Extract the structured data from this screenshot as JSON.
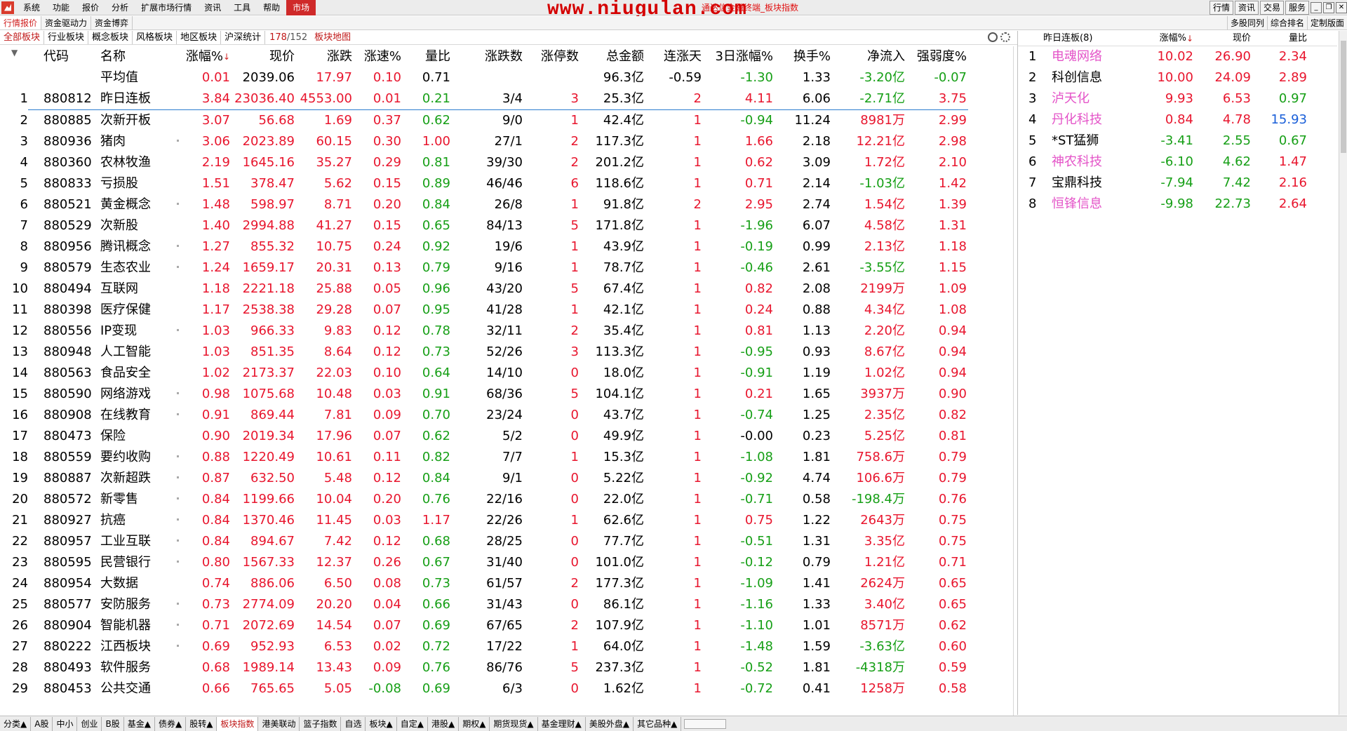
{
  "menubar": {
    "items": [
      "系统",
      "功能",
      "报价",
      "分析",
      "扩展市场行情",
      "资讯",
      "工具",
      "帮助"
    ],
    "active": "市场",
    "title": "通达信金融终端_板块指数",
    "watermark": "www.niugulan.com",
    "right_buttons": [
      "行情",
      "资讯",
      "交易",
      "服务"
    ]
  },
  "tabbar1": {
    "tabs": [
      "行情报价",
      "资金驱动力",
      "资金博弈"
    ],
    "right_tabs": [
      "多股同列",
      "综合排名",
      "定制版面"
    ]
  },
  "tabbar2": {
    "tabs": [
      "全部板块",
      "行业板块",
      "概念板块",
      "风格板块",
      "地区板块",
      "沪深统计"
    ],
    "count": "178",
    "total": "/152",
    "map": "板块地图"
  },
  "headers": {
    "code": "代码",
    "name": "名称",
    "pct": "涨幅%",
    "px": "现价",
    "chg": "涨跌",
    "spd": "涨速%",
    "vr": "量比",
    "ud": "涨跌数",
    "lu": "涨停数",
    "amt": "总金额",
    "cd": "连涨天",
    "d3": "3日涨幅%",
    "tr": "换手%",
    "nf": "净流入",
    "st": "强弱度%",
    "sort_arrow": "↓"
  },
  "average": {
    "name": "平均值",
    "pct": "0.01",
    "px": "2039.06",
    "chg": "17.97",
    "spd": "0.10",
    "vr": "0.71",
    "amt": "96.3亿",
    "cd": "-0.59",
    "d3": "-1.30",
    "tr": "1.33",
    "nf": "-3.20亿",
    "st": "-0.07"
  },
  "rows": [
    {
      "n": "1",
      "code": "880812",
      "name": "昨日连板",
      "pct": "3.84",
      "px": "23036.40",
      "chg": "4553.00",
      "spd": "0.01",
      "vr": "0.21",
      "ud": "3/4",
      "lu": "3",
      "amt": "25.3亿",
      "cd": "2",
      "d3": "4.11",
      "tr": "6.06",
      "nf": "-2.71亿",
      "st": "3.75"
    },
    {
      "n": "2",
      "code": "880885",
      "name": "次新开板",
      "pct": "3.07",
      "px": "56.68",
      "chg": "1.69",
      "spd": "0.37",
      "vr": "0.62",
      "ud": "9/0",
      "lu": "1",
      "amt": "42.4亿",
      "cd": "1",
      "d3": "-0.94",
      "tr": "11.24",
      "nf": "8981万",
      "st": "2.99"
    },
    {
      "n": "3",
      "code": "880936",
      "name": "猪肉",
      "pct": "3.06",
      "px": "2023.89",
      "chg": "60.15",
      "spd": "0.30",
      "vr": "1.00",
      "ud": "27/1",
      "lu": "2",
      "amt": "117.3亿",
      "cd": "1",
      "d3": "1.66",
      "tr": "2.18",
      "nf": "12.21亿",
      "st": "2.98"
    },
    {
      "n": "4",
      "code": "880360",
      "name": "农林牧渔",
      "pct": "2.19",
      "px": "1645.16",
      "chg": "35.27",
      "spd": "0.29",
      "vr": "0.81",
      "ud": "39/30",
      "lu": "2",
      "amt": "201.2亿",
      "cd": "1",
      "d3": "0.62",
      "tr": "3.09",
      "nf": "1.72亿",
      "st": "2.10"
    },
    {
      "n": "5",
      "code": "880833",
      "name": "亏损股",
      "pct": "1.51",
      "px": "378.47",
      "chg": "5.62",
      "spd": "0.15",
      "vr": "0.89",
      "ud": "46/46",
      "lu": "6",
      "amt": "118.6亿",
      "cd": "1",
      "d3": "0.71",
      "tr": "2.14",
      "nf": "-1.03亿",
      "st": "1.42"
    },
    {
      "n": "6",
      "code": "880521",
      "name": "黄金概念",
      "pct": "1.48",
      "px": "598.97",
      "chg": "8.71",
      "spd": "0.20",
      "vr": "0.84",
      "ud": "26/8",
      "lu": "1",
      "amt": "91.8亿",
      "cd": "2",
      "d3": "2.95",
      "tr": "2.74",
      "nf": "1.54亿",
      "st": "1.39"
    },
    {
      "n": "7",
      "code": "880529",
      "name": "次新股",
      "pct": "1.40",
      "px": "2994.88",
      "chg": "41.27",
      "spd": "0.15",
      "vr": "0.65",
      "ud": "84/13",
      "lu": "5",
      "amt": "171.8亿",
      "cd": "1",
      "d3": "-1.96",
      "tr": "6.07",
      "nf": "4.58亿",
      "st": "1.31"
    },
    {
      "n": "8",
      "code": "880956",
      "name": "腾讯概念",
      "pct": "1.27",
      "px": "855.32",
      "chg": "10.75",
      "spd": "0.24",
      "vr": "0.92",
      "ud": "19/6",
      "lu": "1",
      "amt": "43.9亿",
      "cd": "1",
      "d3": "-0.19",
      "tr": "0.99",
      "nf": "2.13亿",
      "st": "1.18"
    },
    {
      "n": "9",
      "code": "880579",
      "name": "生态农业",
      "pct": "1.24",
      "px": "1659.17",
      "chg": "20.31",
      "spd": "0.13",
      "vr": "0.79",
      "ud": "9/16",
      "lu": "1",
      "amt": "78.7亿",
      "cd": "1",
      "d3": "-0.46",
      "tr": "2.61",
      "nf": "-3.55亿",
      "st": "1.15"
    },
    {
      "n": "10",
      "code": "880494",
      "name": "互联网",
      "pct": "1.18",
      "px": "2221.18",
      "chg": "25.88",
      "spd": "0.05",
      "vr": "0.96",
      "ud": "43/20",
      "lu": "5",
      "amt": "67.4亿",
      "cd": "1",
      "d3": "0.82",
      "tr": "2.08",
      "nf": "2199万",
      "st": "1.09"
    },
    {
      "n": "11",
      "code": "880398",
      "name": "医疗保健",
      "pct": "1.17",
      "px": "2538.38",
      "chg": "29.28",
      "spd": "0.07",
      "vr": "0.95",
      "ud": "41/28",
      "lu": "1",
      "amt": "42.1亿",
      "cd": "1",
      "d3": "0.24",
      "tr": "0.88",
      "nf": "4.34亿",
      "st": "1.08"
    },
    {
      "n": "12",
      "code": "880556",
      "name": "IP变现",
      "pct": "1.03",
      "px": "966.33",
      "chg": "9.83",
      "spd": "0.12",
      "vr": "0.78",
      "ud": "32/11",
      "lu": "2",
      "amt": "35.4亿",
      "cd": "1",
      "d3": "0.81",
      "tr": "1.13",
      "nf": "2.20亿",
      "st": "0.94"
    },
    {
      "n": "13",
      "code": "880948",
      "name": "人工智能",
      "pct": "1.03",
      "px": "851.35",
      "chg": "8.64",
      "spd": "0.12",
      "vr": "0.73",
      "ud": "52/26",
      "lu": "3",
      "amt": "113.3亿",
      "cd": "1",
      "d3": "-0.95",
      "tr": "0.93",
      "nf": "8.67亿",
      "st": "0.94"
    },
    {
      "n": "14",
      "code": "880563",
      "name": "食品安全",
      "pct": "1.02",
      "px": "2173.37",
      "chg": "22.03",
      "spd": "0.10",
      "vr": "0.64",
      "ud": "14/10",
      "lu": "0",
      "amt": "18.0亿",
      "cd": "1",
      "d3": "-0.91",
      "tr": "1.19",
      "nf": "1.02亿",
      "st": "0.94"
    },
    {
      "n": "15",
      "code": "880590",
      "name": "网络游戏",
      "pct": "0.98",
      "px": "1075.68",
      "chg": "10.48",
      "spd": "0.03",
      "vr": "0.91",
      "ud": "68/36",
      "lu": "5",
      "amt": "104.1亿",
      "cd": "1",
      "d3": "0.21",
      "tr": "1.65",
      "nf": "3937万",
      "st": "0.90"
    },
    {
      "n": "16",
      "code": "880908",
      "name": "在线教育",
      "pct": "0.91",
      "px": "869.44",
      "chg": "7.81",
      "spd": "0.09",
      "vr": "0.70",
      "ud": "23/24",
      "lu": "0",
      "amt": "43.7亿",
      "cd": "1",
      "d3": "-0.74",
      "tr": "1.25",
      "nf": "2.35亿",
      "st": "0.82"
    },
    {
      "n": "17",
      "code": "880473",
      "name": "保险",
      "pct": "0.90",
      "px": "2019.34",
      "chg": "17.96",
      "spd": "0.07",
      "vr": "0.62",
      "ud": "5/2",
      "lu": "0",
      "amt": "49.9亿",
      "cd": "1",
      "d3": "-0.00",
      "tr": "0.23",
      "nf": "5.25亿",
      "st": "0.81"
    },
    {
      "n": "18",
      "code": "880559",
      "name": "要约收购",
      "pct": "0.88",
      "px": "1220.49",
      "chg": "10.61",
      "spd": "0.11",
      "vr": "0.82",
      "ud": "7/7",
      "lu": "1",
      "amt": "15.3亿",
      "cd": "1",
      "d3": "-1.08",
      "tr": "1.81",
      "nf": "758.6万",
      "st": "0.79"
    },
    {
      "n": "19",
      "code": "880887",
      "name": "次新超跌",
      "pct": "0.87",
      "px": "632.50",
      "chg": "5.48",
      "spd": "0.12",
      "vr": "0.84",
      "ud": "9/1",
      "lu": "0",
      "amt": "5.22亿",
      "cd": "1",
      "d3": "-0.92",
      "tr": "4.74",
      "nf": "106.6万",
      "st": "0.79"
    },
    {
      "n": "20",
      "code": "880572",
      "name": "新零售",
      "pct": "0.84",
      "px": "1199.66",
      "chg": "10.04",
      "spd": "0.20",
      "vr": "0.76",
      "ud": "22/16",
      "lu": "0",
      "amt": "22.0亿",
      "cd": "1",
      "d3": "-0.71",
      "tr": "0.58",
      "nf": "-198.4万",
      "st": "0.76"
    },
    {
      "n": "21",
      "code": "880927",
      "name": "抗癌",
      "pct": "0.84",
      "px": "1370.46",
      "chg": "11.45",
      "spd": "0.03",
      "vr": "1.17",
      "ud": "22/26",
      "lu": "1",
      "amt": "62.6亿",
      "cd": "1",
      "d3": "0.75",
      "tr": "1.22",
      "nf": "2643万",
      "st": "0.75"
    },
    {
      "n": "22",
      "code": "880957",
      "name": "工业互联",
      "pct": "0.84",
      "px": "894.67",
      "chg": "7.42",
      "spd": "0.12",
      "vr": "0.68",
      "ud": "28/25",
      "lu": "0",
      "amt": "77.7亿",
      "cd": "1",
      "d3": "-0.51",
      "tr": "1.31",
      "nf": "3.35亿",
      "st": "0.75"
    },
    {
      "n": "23",
      "code": "880595",
      "name": "民营银行",
      "pct": "0.80",
      "px": "1567.33",
      "chg": "12.37",
      "spd": "0.26",
      "vr": "0.67",
      "ud": "31/40",
      "lu": "0",
      "amt": "101.0亿",
      "cd": "1",
      "d3": "-0.12",
      "tr": "0.79",
      "nf": "1.21亿",
      "st": "0.71"
    },
    {
      "n": "24",
      "code": "880954",
      "name": "大数据",
      "pct": "0.74",
      "px": "886.06",
      "chg": "6.50",
      "spd": "0.08",
      "vr": "0.73",
      "ud": "61/57",
      "lu": "2",
      "amt": "177.3亿",
      "cd": "1",
      "d3": "-1.09",
      "tr": "1.41",
      "nf": "2624万",
      "st": "0.65"
    },
    {
      "n": "25",
      "code": "880577",
      "name": "安防服务",
      "pct": "0.73",
      "px": "2774.09",
      "chg": "20.20",
      "spd": "0.04",
      "vr": "0.66",
      "ud": "31/43",
      "lu": "0",
      "amt": "86.1亿",
      "cd": "1",
      "d3": "-1.16",
      "tr": "1.33",
      "nf": "3.40亿",
      "st": "0.65"
    },
    {
      "n": "26",
      "code": "880904",
      "name": "智能机器",
      "pct": "0.71",
      "px": "2072.69",
      "chg": "14.54",
      "spd": "0.07",
      "vr": "0.69",
      "ud": "67/65",
      "lu": "2",
      "amt": "107.9亿",
      "cd": "1",
      "d3": "-1.10",
      "tr": "1.01",
      "nf": "8571万",
      "st": "0.62"
    },
    {
      "n": "27",
      "code": "880222",
      "name": "江西板块",
      "pct": "0.69",
      "px": "952.93",
      "chg": "6.53",
      "spd": "0.02",
      "vr": "0.72",
      "ud": "17/22",
      "lu": "1",
      "amt": "64.0亿",
      "cd": "1",
      "d3": "-1.48",
      "tr": "1.59",
      "nf": "-3.63亿",
      "st": "0.60"
    },
    {
      "n": "28",
      "code": "880493",
      "name": "软件服务",
      "pct": "0.68",
      "px": "1989.14",
      "chg": "13.43",
      "spd": "0.09",
      "vr": "0.76",
      "ud": "86/76",
      "lu": "5",
      "amt": "237.3亿",
      "cd": "1",
      "d3": "-0.52",
      "tr": "1.81",
      "nf": "-4318万",
      "st": "0.59"
    },
    {
      "n": "29",
      "code": "880453",
      "name": "公共交通",
      "pct": "0.66",
      "px": "765.65",
      "chg": "5.05",
      "spd": "-0.08",
      "vr": "0.69",
      "ud": "6/3",
      "lu": "0",
      "amt": "1.62亿",
      "cd": "1",
      "d3": "-0.72",
      "tr": "0.41",
      "nf": "1258万",
      "st": "0.58"
    }
  ],
  "right_panel": {
    "title": "昨日连板(8)",
    "headers": {
      "pct": "涨幅%",
      "px": "现价",
      "vr": "量比"
    },
    "rows": [
      {
        "n": "1",
        "name": "电魂网络",
        "pct": "10.02",
        "px": "26.90",
        "vr": "2.34",
        "pink": true
      },
      {
        "n": "2",
        "name": "科创信息",
        "pct": "10.00",
        "px": "24.09",
        "vr": "2.89",
        "pink": false
      },
      {
        "n": "3",
        "name": "泸天化",
        "pct": "9.93",
        "px": "6.53",
        "vr": "0.97",
        "pink": true
      },
      {
        "n": "4",
        "name": "丹化科技",
        "pct": "0.84",
        "px": "4.78",
        "vr": "15.93",
        "pink": true
      },
      {
        "n": "5",
        "name": "*ST猛狮",
        "pct": "-3.41",
        "px": "2.55",
        "vr": "0.67",
        "pink": false
      },
      {
        "n": "6",
        "name": "神农科技",
        "pct": "-6.10",
        "px": "4.62",
        "vr": "1.47",
        "pink": true
      },
      {
        "n": "7",
        "name": "宝鼎科技",
        "pct": "-7.94",
        "px": "7.42",
        "vr": "2.16",
        "pink": false
      },
      {
        "n": "8",
        "name": "恒锋信息",
        "pct": "-9.98",
        "px": "22.73",
        "vr": "2.64",
        "pink": true
      }
    ]
  },
  "bottom_tabs": [
    "分类▲",
    "A股",
    "中小",
    "创业",
    "B股",
    "基金▲",
    "债券▲",
    "股转▲",
    "板块指数",
    "港美联动",
    "篮子指数",
    "自选",
    "板块▲",
    "自定▲",
    "港股▲",
    "期权▲",
    "期货现货▲",
    "基金理财▲",
    "美股外盘▲",
    "其它品种▲"
  ],
  "bottom_active": "板块指数",
  "colors": {
    "up": "#e8162e",
    "down": "#169f16",
    "blue": "#1a5fd9",
    "pink": "#e454c8",
    "accent": "#cf2a2a"
  }
}
